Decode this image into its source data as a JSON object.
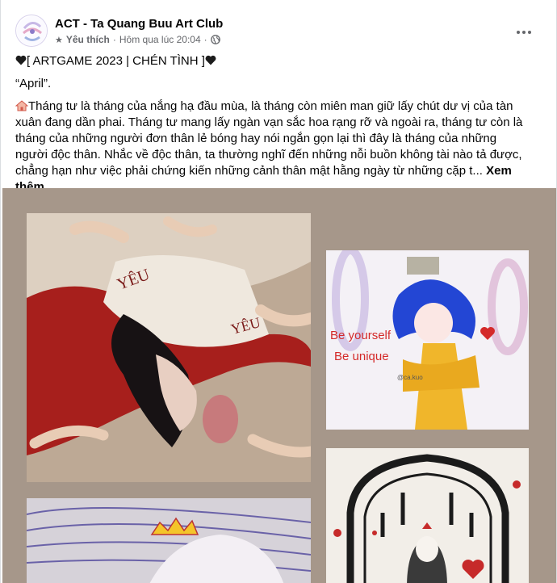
{
  "page": {
    "name": "ACT - Ta Quang Buu Art Club",
    "favorite_label": "Yêu thích",
    "separator": "·",
    "timestamp": "Hôm qua lúc 20:04",
    "privacy_icon": "globe-icon",
    "favorite_icon": "star-icon",
    "more_icon": "more-options-icon"
  },
  "post": {
    "title": "[ ARTGAME 2023 | CHÉN TÌNH ]",
    "quote": "“April”.",
    "body": "Tháng tư là tháng của nắng hạ đầu mùa, là tháng còn miên man giữ lấy chút dư vị của tàn xuân đang dần phai. Tháng tư mang lấy ngàn vạn sắc hoa rạng rỡ và ngoài ra, tháng tư còn là tháng của những người đơn thân lẻ bóng hay nói ngắn gọn lại thì đây là tháng của những người độc thân. Nhắc về độc thân, ta thường nghĩ đến những nỗi buồn không tài nào tả được, chẳng hạn như việc phải chứng kiến những cảnh thân mật hằng ngày từ những cặp t...",
    "see_more": "Xem thêm",
    "heart_color": "#1c1c1c",
    "photos_bg": "#a6978a"
  },
  "artwork": {
    "p1_words": [
      "YÊU",
      "YÊU"
    ],
    "p2_line1": "Be yourself",
    "p2_line2": "Be unique",
    "p2_tag": "@ca.kuo"
  }
}
